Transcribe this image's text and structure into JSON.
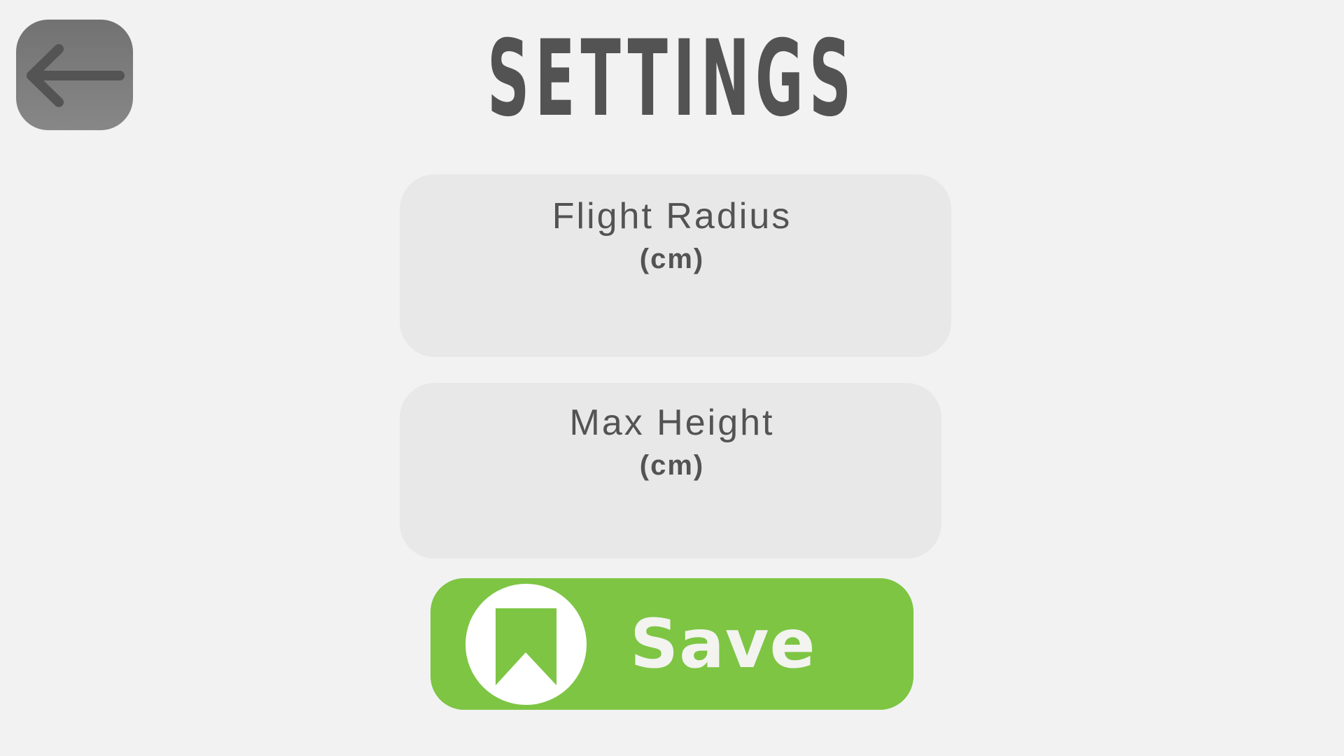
{
  "header": {
    "title": "SETTINGS",
    "back_icon": "arrow-left-icon"
  },
  "settings": [
    {
      "label": "Flight Radius",
      "unit": "(cm)"
    },
    {
      "label": "Max Height",
      "unit": "(cm)"
    }
  ],
  "save": {
    "label": "Save",
    "icon": "bookmark-icon"
  },
  "colors": {
    "background": "#f1f2f1",
    "text": "#535353",
    "card": "#e8e8e8",
    "save_button": "#7dc543",
    "back_button": "#7d7d7d"
  }
}
